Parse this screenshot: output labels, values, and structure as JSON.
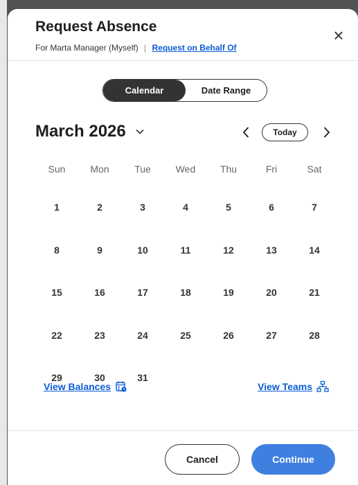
{
  "dialog": {
    "title": "Request Absence",
    "subtitle_text": "For Marta Manager (Myself)",
    "subtitle_separator": "|",
    "behalf_link": "Request on Behalf Of",
    "close_label": "×"
  },
  "view_toggle": {
    "options": [
      "Calendar",
      "Date Range"
    ],
    "selected": "Calendar"
  },
  "calendar": {
    "month_label": "March 2026",
    "today_label": "Today",
    "weekdays": [
      "Sun",
      "Mon",
      "Tue",
      "Wed",
      "Thu",
      "Fri",
      "Sat"
    ],
    "weeks": [
      [
        "1",
        "2",
        "3",
        "4",
        "5",
        "6",
        "7"
      ],
      [
        "8",
        "9",
        "10",
        "11",
        "12",
        "13",
        "14"
      ],
      [
        "15",
        "16",
        "17",
        "18",
        "19",
        "20",
        "21"
      ],
      [
        "22",
        "23",
        "24",
        "25",
        "26",
        "27",
        "28"
      ],
      [
        "29",
        "30",
        "31",
        "",
        "",
        "",
        ""
      ]
    ]
  },
  "links": {
    "view_balances": "View Balances",
    "view_teams": "View Teams"
  },
  "footer": {
    "cancel_label": "Cancel",
    "continue_label": "Continue"
  },
  "colors": {
    "accent": "#3f7fe0",
    "link": "#0b5cd5",
    "toggle_active": "#333333"
  },
  "icons": {
    "close": "close-icon",
    "month_dropdown": "chevron-down-icon",
    "prev": "chevron-left-icon",
    "next": "chevron-right-icon",
    "balances": "calendar-balance-icon",
    "teams": "org-chart-icon"
  }
}
